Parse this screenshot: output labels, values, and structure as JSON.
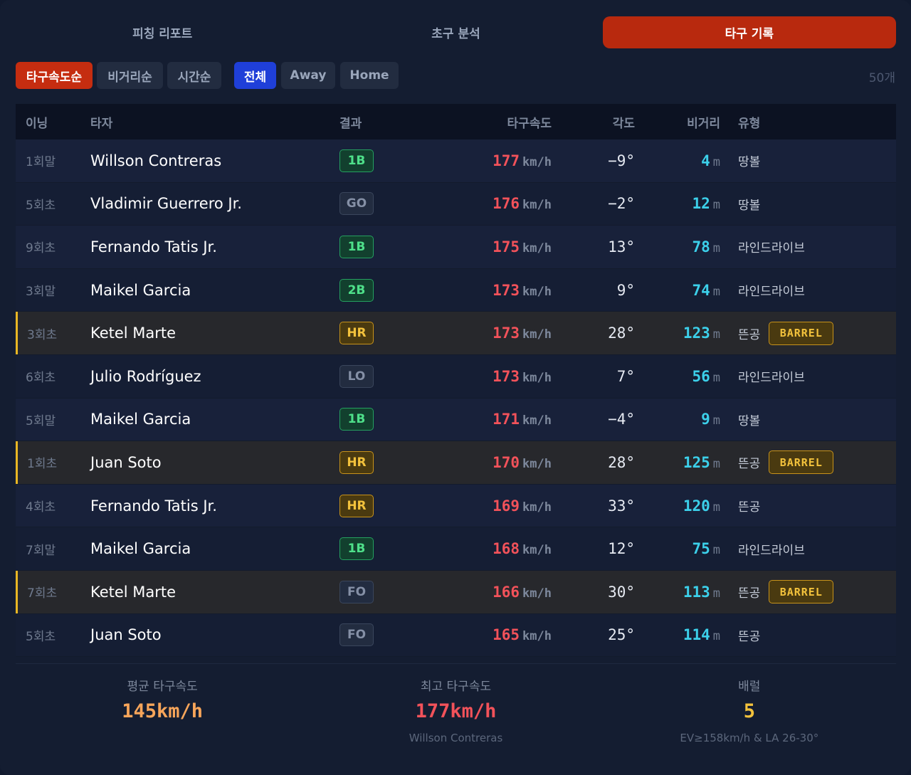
{
  "tabs": [
    {
      "label": "피칭 리포트",
      "active": false
    },
    {
      "label": "초구 분석",
      "active": false
    },
    {
      "label": "타구 기록",
      "active": true
    }
  ],
  "sort_filters": [
    {
      "label": "타구속도순",
      "active": true
    },
    {
      "label": "비거리순",
      "active": false
    },
    {
      "label": "시간순",
      "active": false
    }
  ],
  "side_filters": [
    {
      "label": "전체",
      "active": true
    },
    {
      "label": "Away",
      "active": false
    },
    {
      "label": "Home",
      "active": false
    }
  ],
  "count": "50개",
  "table": {
    "headers": {
      "inning": "이닝",
      "batter": "타자",
      "result": "결과",
      "ev": "타구속도",
      "la": "각도",
      "dist": "비거리",
      "type": "유형"
    },
    "ev_unit": "km/h",
    "dist_unit": "m",
    "barrel_label": "BARREL",
    "rows": [
      {
        "inning": "1회말",
        "batter": "Willson Contreras",
        "result": "1B",
        "ev": "177",
        "la": "−9°",
        "dist": "4",
        "type": "땅볼",
        "barrel": false
      },
      {
        "inning": "5회초",
        "batter": "Vladimir Guerrero Jr.",
        "result": "GO",
        "ev": "176",
        "la": "−2°",
        "dist": "12",
        "type": "땅볼",
        "barrel": false
      },
      {
        "inning": "9회초",
        "batter": "Fernando Tatis Jr.",
        "result": "1B",
        "ev": "175",
        "la": "13°",
        "dist": "78",
        "type": "라인드라이브",
        "barrel": false
      },
      {
        "inning": "3회말",
        "batter": "Maikel Garcia",
        "result": "2B",
        "ev": "173",
        "la": "9°",
        "dist": "74",
        "type": "라인드라이브",
        "barrel": false
      },
      {
        "inning": "3회초",
        "batter": "Ketel Marte",
        "result": "HR",
        "ev": "173",
        "la": "28°",
        "dist": "123",
        "type": "뜬공",
        "barrel": true
      },
      {
        "inning": "6회초",
        "batter": "Julio Rodríguez",
        "result": "LO",
        "ev": "173",
        "la": "7°",
        "dist": "56",
        "type": "라인드라이브",
        "barrel": false
      },
      {
        "inning": "5회말",
        "batter": "Maikel Garcia",
        "result": "1B",
        "ev": "171",
        "la": "−4°",
        "dist": "9",
        "type": "땅볼",
        "barrel": false
      },
      {
        "inning": "1회초",
        "batter": "Juan Soto",
        "result": "HR",
        "ev": "170",
        "la": "28°",
        "dist": "125",
        "type": "뜬공",
        "barrel": true
      },
      {
        "inning": "4회초",
        "batter": "Fernando Tatis Jr.",
        "result": "HR",
        "ev": "169",
        "la": "33°",
        "dist": "120",
        "type": "뜬공",
        "barrel": false
      },
      {
        "inning": "7회말",
        "batter": "Maikel Garcia",
        "result": "1B",
        "ev": "168",
        "la": "12°",
        "dist": "75",
        "type": "라인드라이브",
        "barrel": false
      },
      {
        "inning": "7회초",
        "batter": "Ketel Marte",
        "result": "FO",
        "ev": "166",
        "la": "30°",
        "dist": "113",
        "type": "뜬공",
        "barrel": true
      },
      {
        "inning": "5회초",
        "batter": "Juan Soto",
        "result": "FO",
        "ev": "165",
        "la": "25°",
        "dist": "114",
        "type": "뜬공",
        "barrel": false
      }
    ]
  },
  "summary": [
    {
      "label": "평균 타구속도",
      "value": "145km/h",
      "sub": "",
      "color": "#f7a55a"
    },
    {
      "label": "최고 타구속도",
      "value": "177km/h",
      "sub": "Willson Contreras",
      "color": "#f2525a"
    },
    {
      "label": "배럴",
      "value": "5",
      "sub": "EV≥158km/h & LA 26-30°",
      "color": "#f3c23c"
    }
  ],
  "colors": {
    "accent_red": "#c52d10",
    "active_blue": "#1f3fd8",
    "barrel_yellow": "#e9b724",
    "ev_red": "#f2525a",
    "dist_cyan": "#3cd0ea"
  }
}
